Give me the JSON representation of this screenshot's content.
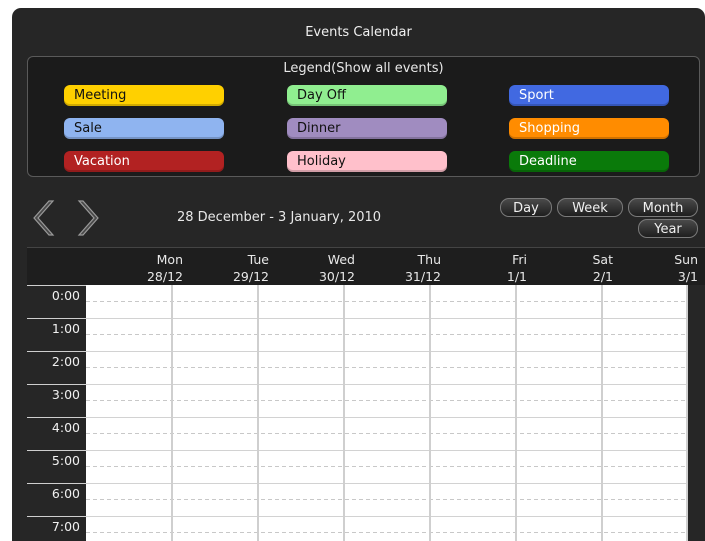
{
  "window": {
    "title": "Events Calendar"
  },
  "legend": {
    "title": "Legend(Show all events)",
    "items": [
      {
        "label": "Meeting",
        "color": "#ffd000"
      },
      {
        "label": "Day Off",
        "color": "#90ee90"
      },
      {
        "label": "Sport",
        "color": "#4169e1"
      },
      {
        "label": "Sale",
        "color": "#8fb4f0"
      },
      {
        "label": "Dinner",
        "color": "#a08cc0"
      },
      {
        "label": "Shopping",
        "color": "#ff8c00"
      },
      {
        "label": "Vacation",
        "color": "#b22222"
      },
      {
        "label": "Holiday",
        "color": "#ffc0cb"
      },
      {
        "label": "Deadline",
        "color": "#0a7a0a"
      }
    ]
  },
  "nav": {
    "prev_icon": "chevron-left-icon",
    "next_icon": "chevron-right-icon"
  },
  "range": "28 December - 3 January, 2010",
  "views": {
    "day": "Day",
    "week": "Week",
    "month": "Month",
    "year": "Year"
  },
  "days": [
    {
      "weekday": "Mon",
      "date": "28/12"
    },
    {
      "weekday": "Tue",
      "date": "29/12"
    },
    {
      "weekday": "Wed",
      "date": "30/12"
    },
    {
      "weekday": "Thu",
      "date": "31/12"
    },
    {
      "weekday": "Fri",
      "date": "1/1"
    },
    {
      "weekday": "Sat",
      "date": "2/1"
    },
    {
      "weekday": "Sun",
      "date": "3/1"
    }
  ],
  "hours": [
    "0:00",
    "1:00",
    "2:00",
    "3:00",
    "4:00",
    "5:00",
    "6:00",
    "7:00"
  ]
}
